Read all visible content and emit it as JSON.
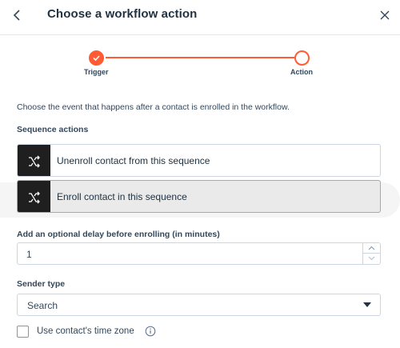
{
  "header": {
    "title": "Choose a workflow action",
    "back_icon": "chevron-left-icon",
    "close_icon": "close-icon"
  },
  "stepper": {
    "steps": [
      {
        "label": "Trigger",
        "state": "completed"
      },
      {
        "label": "Action",
        "state": "current"
      }
    ],
    "accent_color": "#ff5c35"
  },
  "intro_text": "Choose the event that happens after a contact is enrolled in the workflow.",
  "sequence_actions": {
    "title": "Sequence actions",
    "items": [
      {
        "label": "Unenroll contact from this sequence",
        "icon": "sequence-icon",
        "selected": false
      },
      {
        "label": "Enroll contact in this sequence",
        "icon": "sequence-icon",
        "selected": true
      }
    ]
  },
  "delay": {
    "label": "Add an optional delay before enrolling (in minutes)",
    "value": "1"
  },
  "sender_type": {
    "label": "Sender type",
    "value": "Search"
  },
  "timezone": {
    "label": "Use contact's time zone",
    "checked": false
  }
}
